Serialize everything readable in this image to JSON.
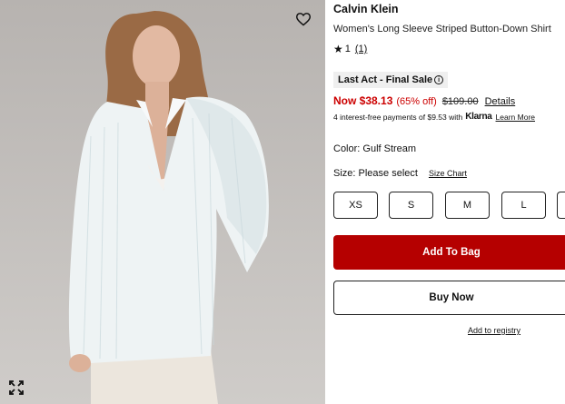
{
  "product": {
    "brand": "Calvin Klein",
    "name": "Women's Long Sleeve Striped Button-Down Shirt",
    "rating": {
      "star_glyph": "★",
      "value": "1",
      "count": "(1)"
    },
    "badge": {
      "label": "Last Act - Final Sale",
      "info_glyph": "i"
    },
    "price": {
      "now": "Now $38.13",
      "discount": "(65% off)",
      "original": "$109.00",
      "details_label": "Details"
    },
    "klarna": {
      "text": "4 interest-free payments of $9.53 with",
      "logo": "Klarna",
      "learn_more": "Learn More"
    },
    "color": "Color: Gulf Stream",
    "size": {
      "label": "Size: Please select",
      "chart_label": "Size Chart",
      "options": [
        "XS",
        "S",
        "M",
        "L"
      ]
    }
  },
  "actions": {
    "add_to_bag": "Add To Bag",
    "buy_now": "Buy Now",
    "registry": "Add to registry"
  },
  "icons": {
    "wishlist": "heart-outline-icon",
    "expand": "expand-arrows-icon"
  },
  "colors": {
    "sale_red": "#cc0000",
    "add_to_bag_bg": "#b50000",
    "badge_bg": "#efefef"
  }
}
